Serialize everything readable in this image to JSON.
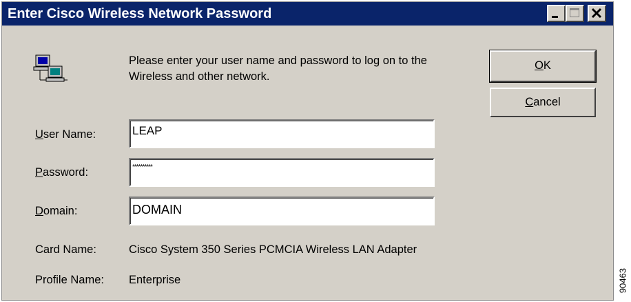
{
  "window": {
    "title": "Enter Cisco Wireless Network Password",
    "minimize_icon": "minimize-icon",
    "maximize_icon": "maximize-icon",
    "close_icon": "close-icon"
  },
  "icon": "network-computers-icon",
  "message": "Please enter your user name and password to log on to the Wireless and other network.",
  "buttons": {
    "ok_mnemonic": "O",
    "ok_rest": "K",
    "cancel_mnemonic": "C",
    "cancel_rest": "ancel"
  },
  "fields": {
    "username": {
      "label_mnemonic": "U",
      "label_rest": "ser Name:",
      "value": "LEAP"
    },
    "password": {
      "label_mnemonic": "P",
      "label_rest": "assword:",
      "value": "**********"
    },
    "domain": {
      "label_mnemonic": "D",
      "label_rest": "omain:",
      "value": "DOMAIN"
    }
  },
  "info": {
    "card_label": "Card Name:",
    "card_value": "Cisco System 350 Series PCMCIA Wireless LAN Adapter",
    "profile_label": "Profile Name:",
    "profile_value": "Enterprise"
  },
  "figure_id": "90463",
  "colors": {
    "titlebar": "#0a246a",
    "dialog_bg": "#d4d0c8"
  }
}
